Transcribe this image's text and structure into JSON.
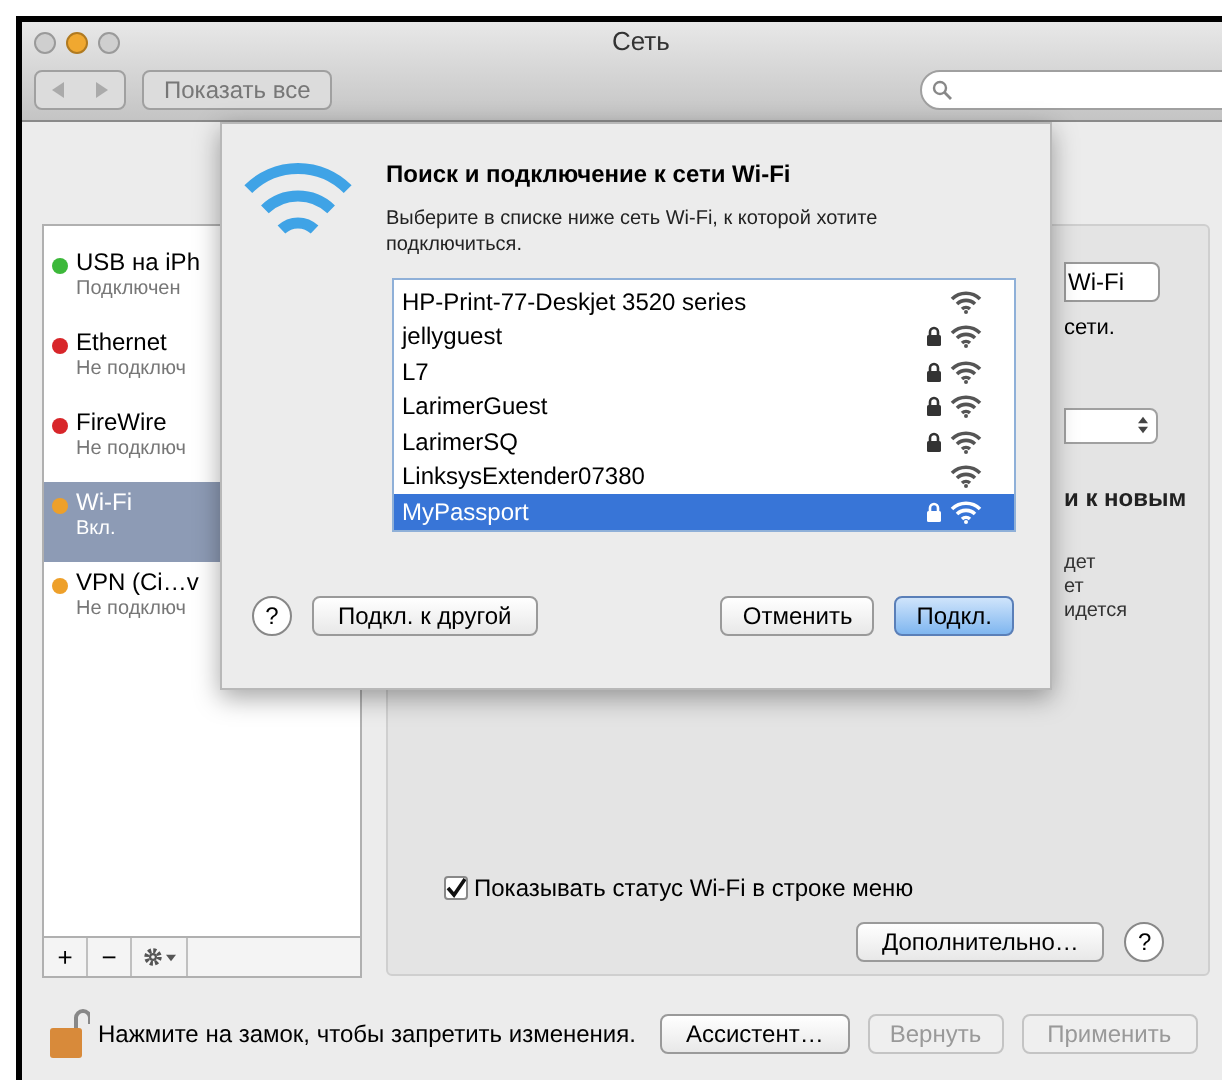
{
  "window": {
    "title": "Сеть"
  },
  "toolbar": {
    "show_all": "Показать все"
  },
  "sidebar": {
    "items": [
      {
        "name": "USB на iPh",
        "status": "Подключен",
        "color": "#3cb83a",
        "selected": false
      },
      {
        "name": "Ethernet",
        "status": "Не подключ",
        "color": "#d8262a",
        "selected": false
      },
      {
        "name": "FireWire",
        "status": "Не подключ",
        "color": "#d8262a",
        "selected": false
      },
      {
        "name": "Wi-Fi",
        "status": "Вкл.",
        "color": "#eea02a",
        "selected": true
      },
      {
        "name": "VPN (Ci…v",
        "status": "Не подключ",
        "color": "#eea02a",
        "selected": false
      }
    ],
    "buttons": [
      "+",
      "−"
    ]
  },
  "panel": {
    "fragments": [
      {
        "kind": "button",
        "text": "Wi-Fi"
      },
      {
        "kind": "text",
        "text": "сети."
      },
      {
        "kind": "popup"
      },
      {
        "kind": "bold",
        "text": "и к новым"
      },
      {
        "kind": "small",
        "text": "дет"
      },
      {
        "kind": "small",
        "text": "ет"
      },
      {
        "kind": "small",
        "text": "идется"
      }
    ],
    "show_status": {
      "label": "Показывать статус Wi-Fi в строке меню",
      "checked": true
    },
    "advanced": "Дополнительно…",
    "help": "?"
  },
  "dialog": {
    "title": "Поиск и подключение к сети Wi-Fi",
    "text": "Выберите в списке ниже сеть Wi-Fi, к которой хотите подключиться.",
    "networks": [
      {
        "name": "HP-Print-77-Deskjet 3520 series",
        "locked": false,
        "selected": false
      },
      {
        "name": "jellyguest",
        "locked": true,
        "selected": false
      },
      {
        "name": "L7",
        "locked": true,
        "selected": false
      },
      {
        "name": "LarimerGuest",
        "locked": true,
        "selected": false
      },
      {
        "name": "LarimerSQ",
        "locked": true,
        "selected": false
      },
      {
        "name": "LinksysExtender07380",
        "locked": false,
        "selected": false
      },
      {
        "name": "MyPassport",
        "locked": true,
        "selected": true
      }
    ],
    "help": "?",
    "other": "Подкл. к другой",
    "cancel": "Отменить",
    "connect": "Подкл."
  },
  "footer": {
    "lock_text": "Нажмите на замок, чтобы запретить изменения.",
    "assistant": "Ассистент…",
    "revert": "Вернуть",
    "apply": "Применить"
  }
}
